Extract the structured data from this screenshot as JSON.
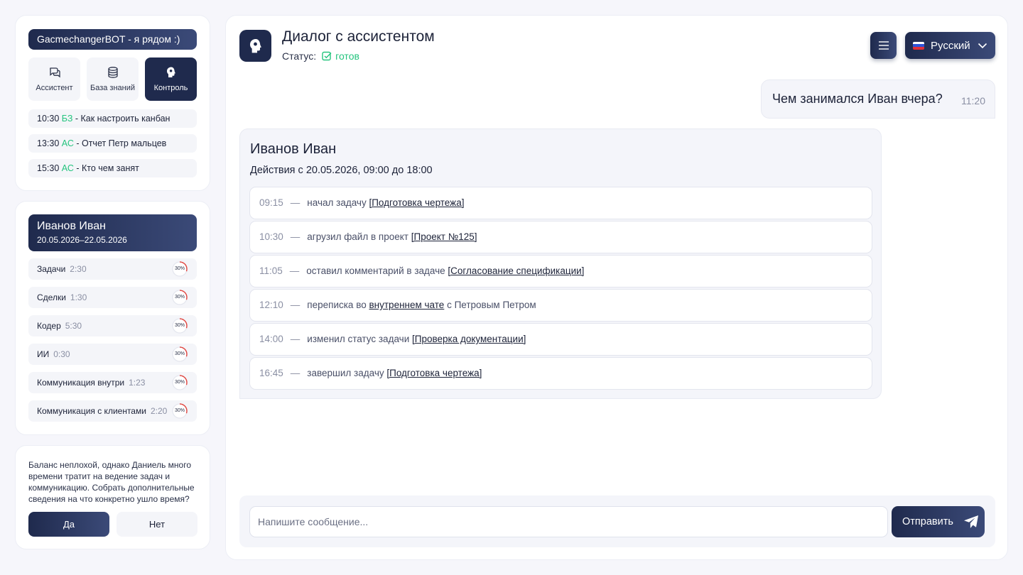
{
  "sidebar": {
    "bot_title": "GacmechangerBOT - я рядом :)",
    "tabs": [
      {
        "label": "Ассистент",
        "icon": "chat-bubbles-icon",
        "active": false
      },
      {
        "label": "База знаний",
        "icon": "database-icon",
        "active": false
      },
      {
        "label": "Контроль",
        "icon": "head-brain-icon",
        "active": true
      }
    ],
    "history": [
      {
        "time": "10:30",
        "tag": "БЗ",
        "text": "- Как настроить канбан"
      },
      {
        "time": "13:30",
        "tag": "АС",
        "text": "- Отчет Петр мальцев"
      },
      {
        "time": "15:30",
        "tag": "АС",
        "text": "- Кто чем занят"
      }
    ],
    "person": {
      "name": "Иванов Иван",
      "dates": "20.05.2026–22.05.2026"
    },
    "metrics": [
      {
        "label": "Задачи",
        "time": "2:30",
        "percent": 30,
        "percent_label": "30%"
      },
      {
        "label": "Сделки",
        "time": "1:30",
        "percent": 30,
        "percent_label": "30%"
      },
      {
        "label": "Кодер",
        "time": "5:30",
        "percent": 30,
        "percent_label": "30%"
      },
      {
        "label": "ИИ",
        "time": "0:30",
        "percent": 30,
        "percent_label": "30%"
      },
      {
        "label": "Коммуникация внутри",
        "time": "1:23",
        "percent": 30,
        "percent_label": "30%"
      },
      {
        "label": "Коммуникация с клиентами",
        "time": "2:20",
        "percent": 30,
        "percent_label": "30%"
      }
    ],
    "advice": "Баланс неплохой, однако Даниель много времени тратит на ведение задач и коммуникацию. Собрать дополнительные сведения на что конкретно ушло время?",
    "yes_label": "Да",
    "no_label": "Нет"
  },
  "header": {
    "title": "Диалог с ассистентом",
    "status_label": "Статус:",
    "status_value": "готов",
    "language": "Русский"
  },
  "chat": {
    "user_message": {
      "text": "Чем занимался Иван вчера?",
      "time": "11:20"
    },
    "reply": {
      "name": "Иванов Иван",
      "subtitle": "Действия с 20.05.2026, 09:00 до 18:00",
      "actions": [
        {
          "time": "09:15",
          "text": "начал задачу",
          "link": "[Подготовка чертежа]",
          "suffix": ""
        },
        {
          "time": "10:30",
          "text": "агрузил файл в проект",
          "link": "[Проект №125]",
          "suffix": ""
        },
        {
          "time": "11:05",
          "text": "оставил комментарий в задаче",
          "link": "[Согласование спецификации]",
          "suffix": ""
        },
        {
          "time": "12:10",
          "text": "переписка во",
          "link": "внутреннем чате",
          "suffix": "с Петровым Петром"
        },
        {
          "time": "14:00",
          "text": "изменил статус задачи",
          "link": "[Проверка документации]",
          "suffix": ""
        },
        {
          "time": "16:45",
          "text": "завершил задачу",
          "link": "[Подготовка чертежа]",
          "suffix": ""
        }
      ]
    }
  },
  "composer": {
    "placeholder": "Напишите сообщение...",
    "send_label": "Отправить"
  },
  "colors": {
    "accent_dark": "#1f2a4d",
    "accent_light": "#3b4a78",
    "success": "#24c47e",
    "gauge": "#e0443e"
  }
}
